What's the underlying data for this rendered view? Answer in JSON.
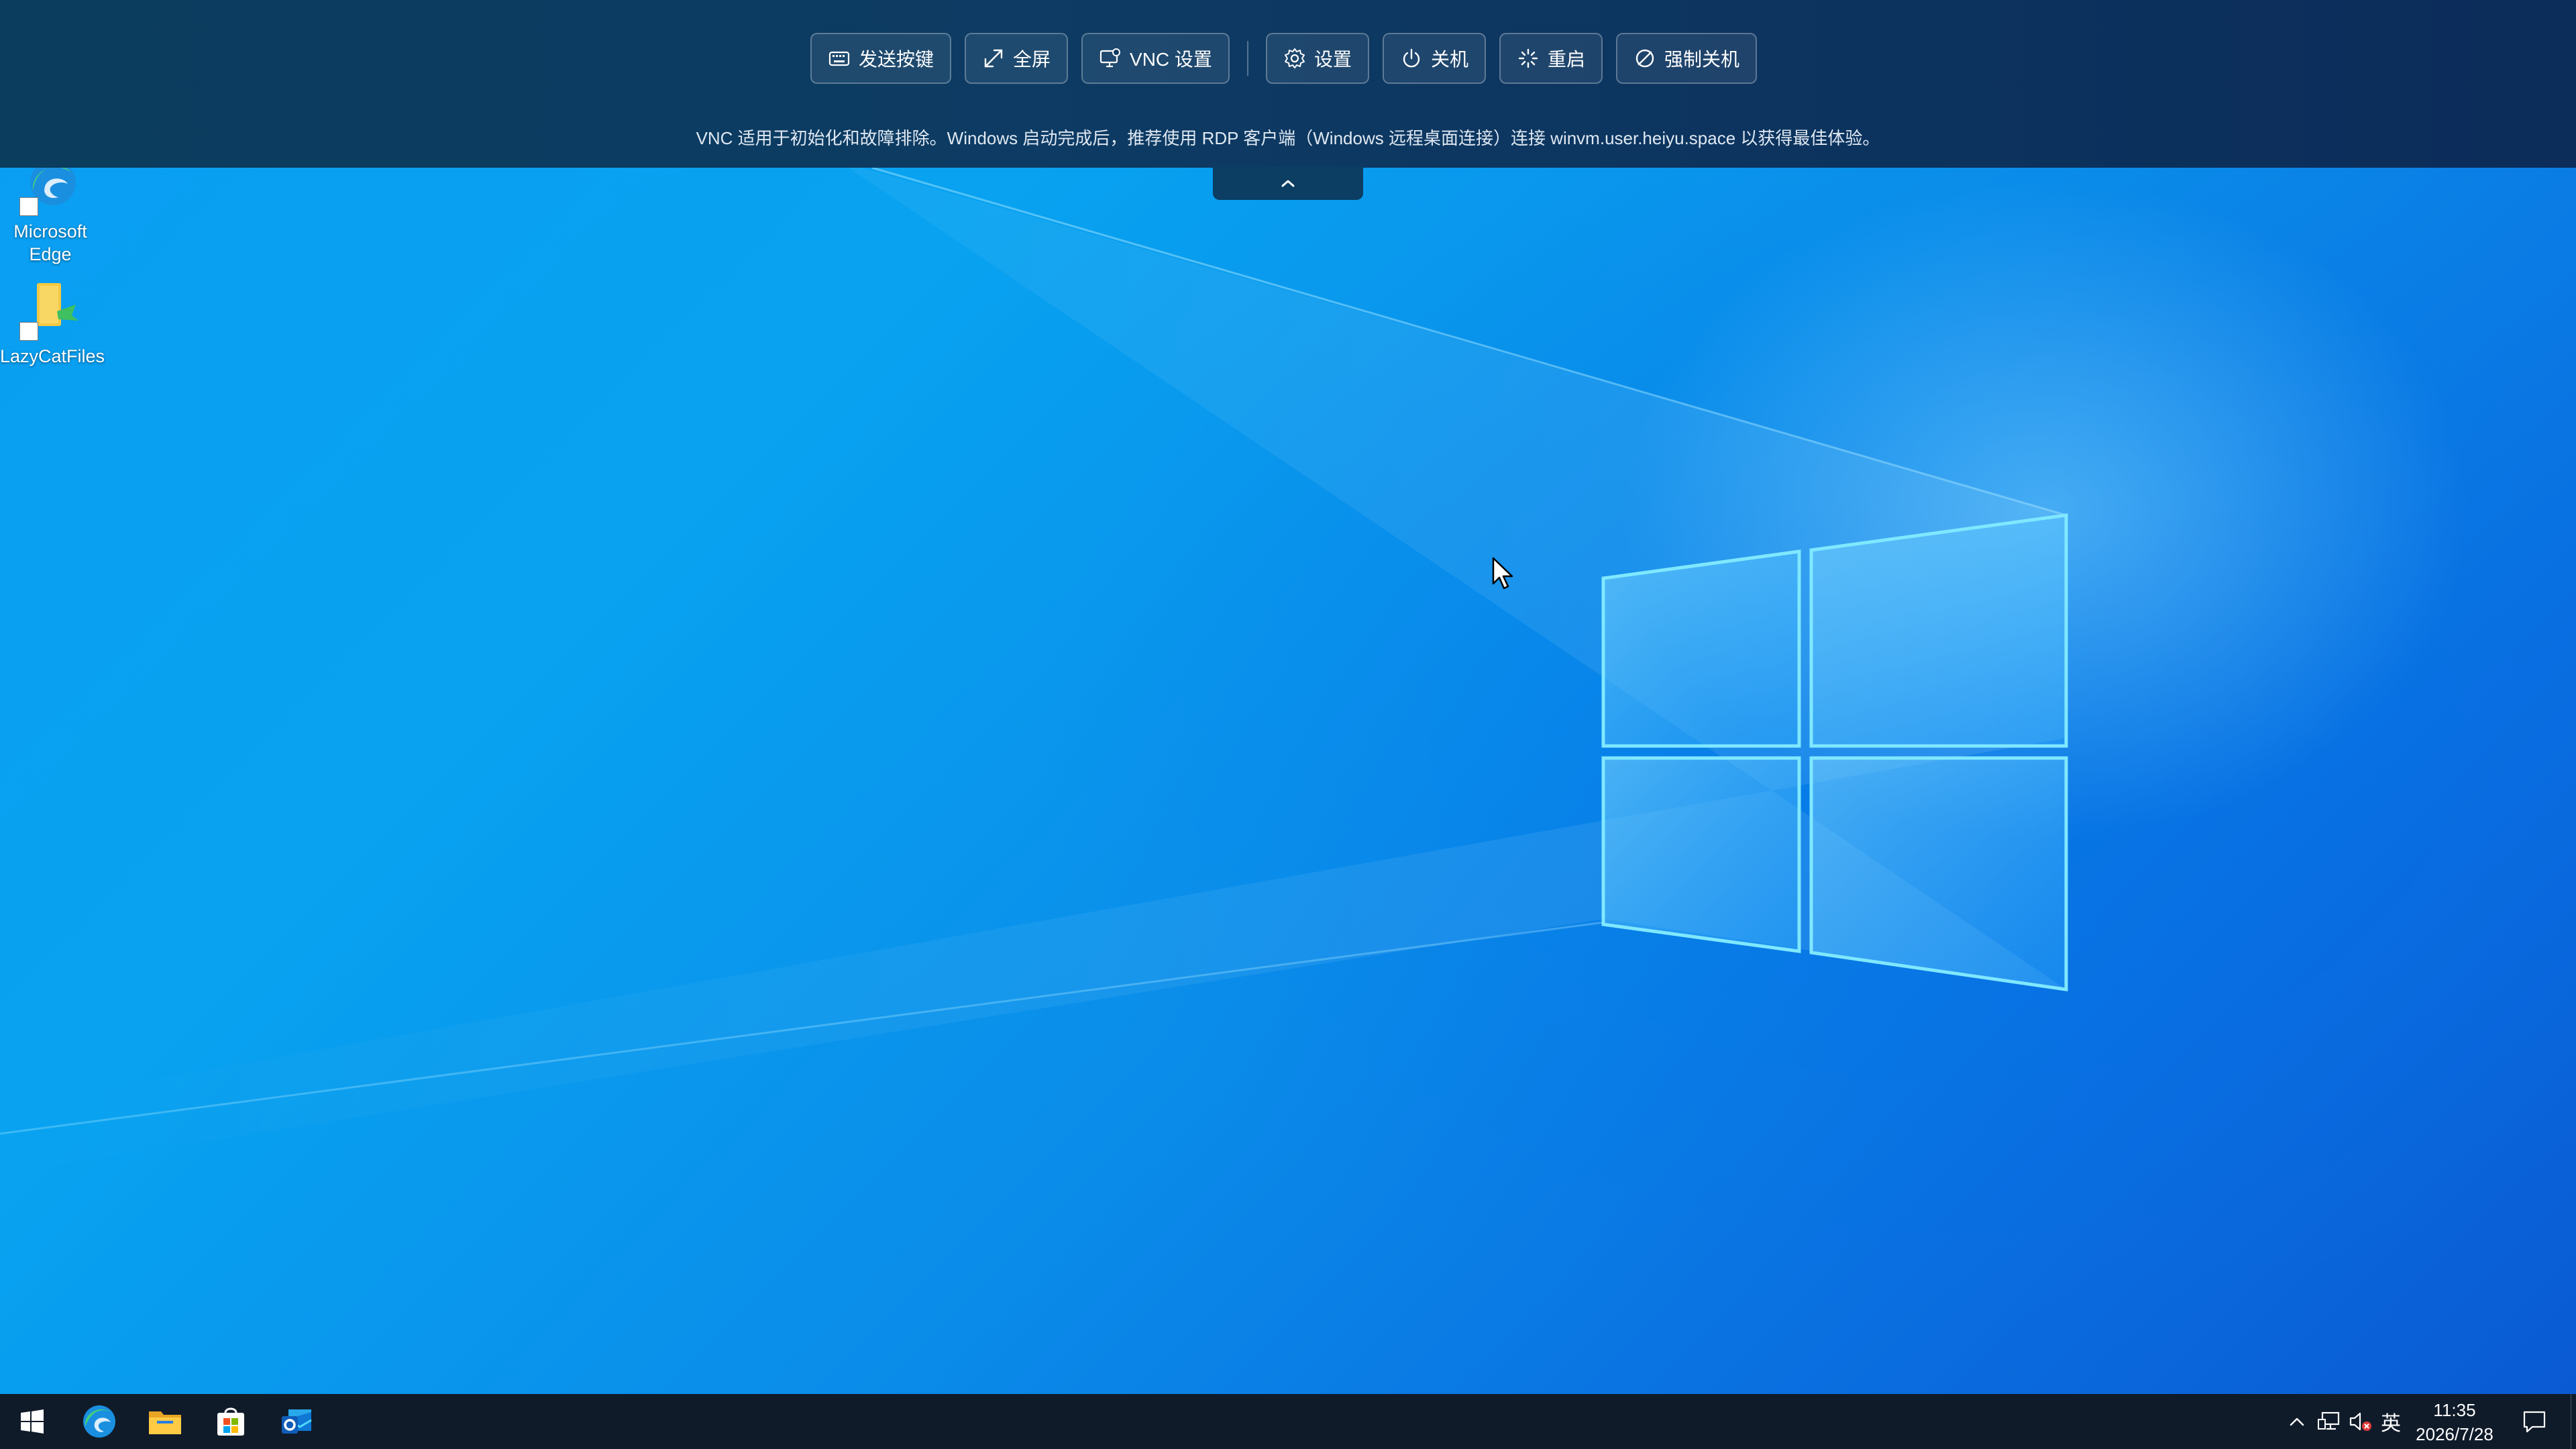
{
  "desktop": {
    "icons": [
      {
        "label": "Microsoft Edge",
        "icon": "edge-icon"
      },
      {
        "label": "LazyCatFiles",
        "icon": "folder-icon"
      }
    ]
  },
  "vnc_toolbar": {
    "buttons": [
      {
        "label": "发送按键",
        "icon": "keyboard-icon"
      },
      {
        "label": "全屏",
        "icon": "expand-icon"
      },
      {
        "label": "VNC 设置",
        "icon": "monitor-settings-icon"
      },
      {
        "label": "设置",
        "icon": "gear-icon"
      },
      {
        "label": "关机",
        "icon": "power-icon"
      },
      {
        "label": "重启",
        "icon": "restart-icon"
      },
      {
        "label": "强制关机",
        "icon": "force-off-icon"
      }
    ],
    "notice": "VNC 适用于初始化和故障排除。Windows 启动完成后，推荐使用 RDP 客户端（Windows 远程桌面连接）连接 winvm.user.heiyu.space 以获得最佳体验。",
    "collapse_icon": "chevron-up-icon"
  },
  "taskbar": {
    "pinned": [
      {
        "name": "start",
        "icon": "windows-start-icon"
      },
      {
        "name": "edge",
        "icon": "edge-icon"
      },
      {
        "name": "file-explorer",
        "icon": "folder-icon"
      },
      {
        "name": "store",
        "icon": "store-icon"
      },
      {
        "name": "outlook",
        "icon": "mail-icon"
      }
    ],
    "tray": {
      "input_method": "英",
      "time": "11:35",
      "date": "2026/7/28",
      "icons": [
        "chevron-up-icon",
        "network-icon",
        "volume-muted-icon",
        "notification-icon"
      ]
    }
  },
  "colors": {
    "toolbar_bg": "#0d3b63",
    "desktop_blue": "#0a9ef2",
    "taskbar_bg": "#101b2a",
    "windows_logo_glow": "#7fe8ff"
  }
}
